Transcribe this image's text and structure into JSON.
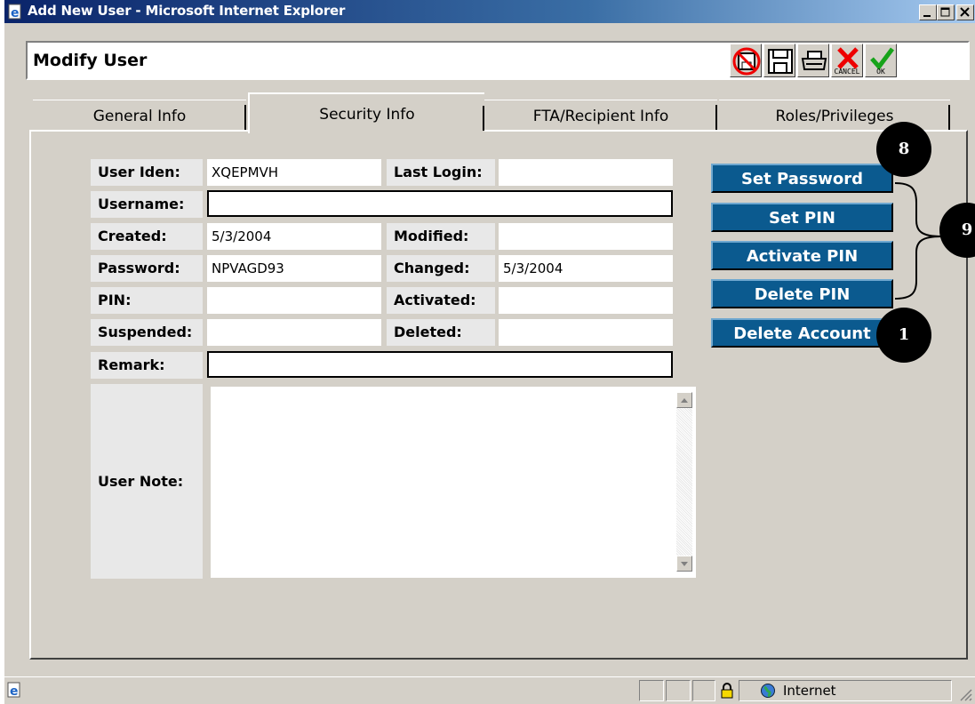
{
  "window": {
    "title": "Add New User - Microsoft Internet Explorer"
  },
  "header": {
    "title": "Modify User",
    "cancel_caption": "CANCEL",
    "ok_caption": "OK"
  },
  "tabs": [
    {
      "label": "General Info"
    },
    {
      "label": "Security Info"
    },
    {
      "label": "FTA/Recipient Info"
    },
    {
      "label": "Roles/Privileges"
    }
  ],
  "form": {
    "user_iden": {
      "label": "User Iden:",
      "value": "XQEPMVH"
    },
    "last_login": {
      "label": "Last Login:",
      "value": ""
    },
    "username": {
      "label": "Username:",
      "value": ""
    },
    "created": {
      "label": "Created:",
      "value": "5/3/2004"
    },
    "modified": {
      "label": "Modified:",
      "value": ""
    },
    "password": {
      "label": "Password:",
      "value": "NPVAGD93"
    },
    "changed": {
      "label": "Changed:",
      "value": "5/3/2004"
    },
    "pin": {
      "label": "PIN:",
      "value": ""
    },
    "activated": {
      "label": "Activated:",
      "value": ""
    },
    "suspended": {
      "label": "Suspended:",
      "value": ""
    },
    "deleted": {
      "label": "Deleted:",
      "value": ""
    },
    "remark": {
      "label": "Remark:",
      "value": ""
    },
    "user_note": {
      "label": "User Note:",
      "value": ""
    }
  },
  "actions": {
    "set_password": "Set Password",
    "set_pin": "Set PIN",
    "activate_pin": "Activate PIN",
    "delete_pin": "Delete PIN",
    "delete_account": "Delete Account"
  },
  "callouts": {
    "a": "8",
    "b": "9",
    "c": "1"
  },
  "statusbar": {
    "zone": "Internet"
  }
}
